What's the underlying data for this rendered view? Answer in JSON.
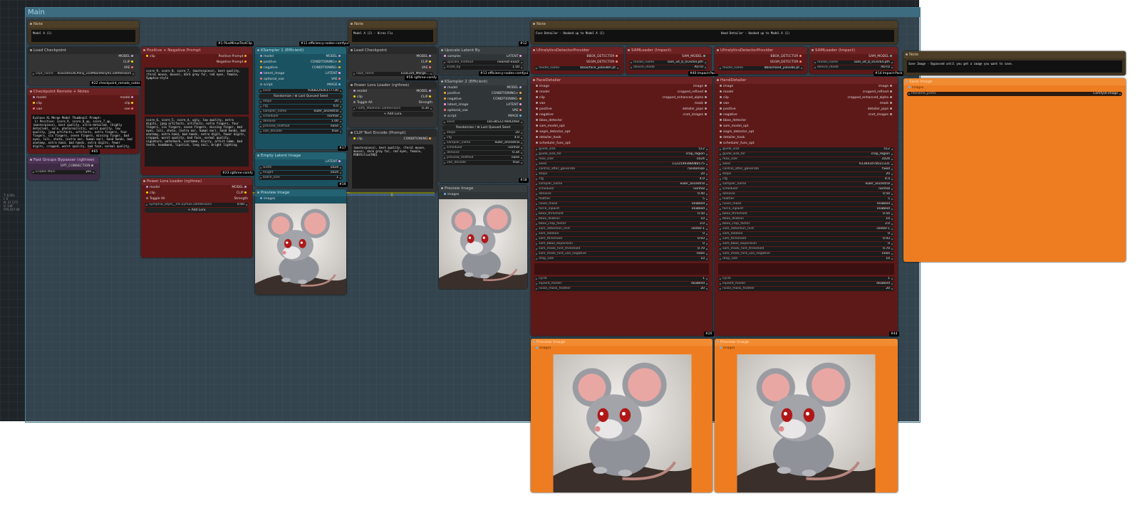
{
  "group": {
    "title": "Main"
  },
  "stats": [
    "T: 6.00s",
    "I: 0",
    "N: 27 [27]",
    "V: 138",
    "FPS:167.00"
  ],
  "notes": {
    "n1": {
      "title": "Note",
      "text": "Model A (1)"
    },
    "n2": {
      "title": "Note",
      "text": "Model A (2) - Hires Fix"
    },
    "n3": {
      "title": "Note",
      "text": "Face Detailer - Hooked up to Model A (1)"
    },
    "n4": {
      "title": "Note",
      "text": "Hand Detailer - Hooked up to Model A (1)"
    },
    "n5": {
      "title": "Note",
      "text": "Save Image - Bypassed until you get a image you want to save."
    }
  },
  "load_ckpt1": {
    "title": "Load Checkpoint",
    "outputs": [
      "MODEL",
      "CLIP",
      "VAE"
    ],
    "widget_label": "ckpt_name",
    "widget_value": "ecacomixXLPony_v10MainPony91.safetensors",
    "badge": "#22 checkpoint_remote_notes"
  },
  "ckpt_remote": {
    "title": "Checkpoint Remote + Notes",
    "inputs": [
      "model",
      "clip",
      "vae"
    ],
    "outputs": [
      "model",
      "clip",
      "vae"
    ],
    "text": "Evalove XL Merge Model Thumbnail Prompt:\n 1) Positive: score_9, score_8_up, score_7_up, (masterpiece), best quality, ultra-detailed, (highly detailed), solo, photorealistic, worst quality, low quality, jpeg artifacts, artifacts, extra fingers, four fingers, six fingers, seven fingers, missing finger, bad eyes, loli, shota, (extra ear, human ear), hand hands, bad anatomy, extra hand, bad hands, extra digits, fewer digits, cropped, worst quality, bad face, normal quality, signature, watermark, username, blurry, artist name, bad teeth, human ear, human ears, headband",
    "badge": "#65"
  },
  "bypasser": {
    "title": "Fast Groups Bypasser (rgthree)",
    "output": "OPT_CONNECTION",
    "label": "Enable Main",
    "value": "yes"
  },
  "prompt": {
    "title": "Positive + Negative Prompt",
    "inputs": [
      "clip"
    ],
    "outputs": [
      "Positive Prompt",
      "Negative Prompt"
    ],
    "badge_top": "#1 PlusMinusTextClip",
    "positive": "score_9, score_8, score_7, (masterpiece), best quality, (feral mouse, mouse), dark grey fur, red eyes, female, Symphia-style",
    "negative": "score_6, score_5, score_4, ugly, low quality, extra digits, jpeg artifacts, artifacts, extra fingers, four fingers, six fingers, seven fingers, missing finger, bad eyes, loli, shota, (extra ear, human ear), hand hands, bad anatomy, extra hand, bad hands, extra digit, fewer digits, cropped, worst quality, bad face, normal quality, signature, watermark, username, blurry, artist name, bad teeth, headband, lipstick, long nail, bright lighting",
    "badge_bottom": "#23 rgthree-comfy"
  },
  "lora1": {
    "title": "Power Lora Loader (rgthree)",
    "inputs": [
      "model",
      "clip"
    ],
    "outputs": [
      "MODEL",
      "CLIP"
    ],
    "toggle": "Toggle All",
    "strength_label": "Strength",
    "lora": "Symphia_Style__V4-Zymox.safetensors",
    "strength": "0.60",
    "add": "Add Lora"
  },
  "ks1": {
    "title": "KSampler 1 (Efficient)",
    "badge": "#11 efficiency-nodes-comfyui",
    "inputs": [
      "model",
      "positive",
      "negative",
      "latent_image",
      "optional_vae",
      "script"
    ],
    "outputs": [
      "MODEL",
      "CONDITIONING+",
      "CONDITIONING-",
      "LATENT",
      "VAE",
      "IMAGE"
    ],
    "seed_label": "seed",
    "seed": "936822926177730",
    "seed_btn": "Randomize / ♻ Last Queued Seed",
    "widgets": [
      [
        "steps",
        "20"
      ],
      [
        "cfg",
        "6.0"
      ],
      [
        "sampler_name",
        "euler_ancestral"
      ],
      [
        "scheduler",
        "normal"
      ],
      [
        "denoise",
        "1.00"
      ],
      [
        "preview_method",
        "none"
      ],
      [
        "vae_decode",
        "true"
      ]
    ],
    "badge2": "#17"
  },
  "latent": {
    "title": "Empty Latent Image",
    "output": "LATENT",
    "widgets": [
      [
        "width",
        "1024"
      ],
      [
        "height",
        "1024"
      ],
      [
        "batch_size",
        "1"
      ]
    ],
    "badge": "#19"
  },
  "preview1": {
    "title": "Preview Image",
    "input": "images"
  },
  "load_ckpt2": {
    "title": "Load Checkpoint",
    "outputs": [
      "MODEL",
      "CLIP",
      "VAE"
    ],
    "widget_label": "ckpt_name",
    "widget_value": "EvaCore_Merge...",
    "badge": "#56 rgthree-comfy"
  },
  "lora2": {
    "title": "Power Lora Loader (rgthree)",
    "inputs": [
      "model",
      "clip"
    ],
    "outputs": [
      "MODEL",
      "CLIP"
    ],
    "toggle": "Toggle All",
    "strength_label": "Strength",
    "lora": "Fluffy_Madness.safetensors",
    "strength": "0.30",
    "add": "Add Lora"
  },
  "clip_enc": {
    "title": "CLIP Text Encode (Prompt)",
    "input": "clip",
    "output": "CONDITIONING",
    "text": "(masterpiece), best quality, (feral mouse, mouse), dark grey fur, red eyes, female, PONYVillanTHS1"
  },
  "upscale": {
    "title": "Upscale Latent By",
    "badge": "#12",
    "input": "samples",
    "output": "LATENT",
    "widgets": [
      [
        "upscale_method",
        "nearest-exact"
      ],
      [
        "scale_by",
        "1.50"
      ]
    ],
    "badge2": "#13 efficiency-nodes-comfyui"
  },
  "ks2": {
    "title": "KSampler 2 (Efficient)",
    "inputs": [
      "model",
      "positive",
      "negative",
      "latent_image",
      "optional_vae",
      "script"
    ],
    "outputs": [
      "MODEL",
      "CONDITIONING+",
      "CONDITIONING-",
      "LATENT",
      "VAE",
      "IMAGE"
    ],
    "seed_label": "seed",
    "seed": "1813852278042064",
    "seed_btn": "Randomize / ♻ Last Queued Seed",
    "widgets": [
      [
        "steps",
        "20"
      ],
      [
        "cfg",
        "4.0"
      ],
      [
        "sampler_name",
        "euler_ancestral"
      ],
      [
        "scheduler",
        "normal"
      ],
      [
        "denoise",
        "0.34"
      ],
      [
        "preview_method",
        "none"
      ],
      [
        "vae_decode",
        "true"
      ]
    ],
    "badge": "#18"
  },
  "preview2": {
    "title": "Preview Image",
    "input": "images"
  },
  "ultra1": {
    "title": "UltralyticsDetectorProvider",
    "outputs": [
      "BBOX_DETECTOR",
      "SEGM_DETECTOR"
    ],
    "label": "model_name",
    "value": "bbox/face_yolov8m.pt"
  },
  "sam1": {
    "title": "SAMLoader (Impact)",
    "output": "SAM_MODEL",
    "widgets": [
      [
        "model_name",
        "sam_vit_b_01ec64.pth"
      ],
      [
        "device_mode",
        "AUTO"
      ]
    ],
    "badge": "#40 Impact-Pack"
  },
  "ultra2": {
    "title": "UltralyticsDetectorProvider",
    "outputs": [
      "BBOX_DETECTOR",
      "SEGM_DETECTOR"
    ],
    "label": "model_name",
    "value": "bbox/hand_yolov8s.pt"
  },
  "sam2": {
    "title": "SAMLoader (Impact)",
    "output": "SAM_MODEL",
    "widgets": [
      [
        "model_name",
        "sam_vit_b_01ec64.pth"
      ],
      [
        "device_mode",
        "AUTO"
      ]
    ],
    "badge": "#14 Impact-Pack"
  },
  "face": {
    "title": "FaceDetailer",
    "inputs": [
      "image",
      "model",
      "clip",
      "vae",
      "positive",
      "negative",
      "bbox_detector",
      "sam_model_opt",
      "segm_detector_opt",
      "detailer_hook",
      "scheduler_func_opt"
    ],
    "outputs": [
      "image",
      "cropped_refined",
      "cropped_enhanced_alpha",
      "mask",
      "detailer_pipe",
      "cnet_images"
    ],
    "widgets": [
      [
        "guide_size",
        "512"
      ],
      [
        "guide_size_for",
        "crop_region"
      ],
      [
        "max_size",
        "1024"
      ],
      [
        "seed",
        "1122549388086575"
      ],
      [
        "control_after_generate",
        "randomize"
      ],
      [
        "steps",
        "20"
      ],
      [
        "cfg",
        "4.0"
      ],
      [
        "sampler_name",
        "euler_ancestral"
      ],
      [
        "scheduler",
        "normal"
      ],
      [
        "denoise",
        "0.40"
      ],
      [
        "feather",
        "5"
      ],
      [
        "noise_mask",
        "enabled"
      ],
      [
        "force_inpaint",
        "enabled"
      ],
      [
        "bbox_threshold",
        "0.50"
      ],
      [
        "bbox_dilation",
        "10"
      ],
      [
        "bbox_crop_factor",
        "3.0"
      ],
      [
        "sam_detection_hint",
        "center-1"
      ],
      [
        "sam_dilation",
        "0"
      ],
      [
        "sam_threshold",
        "0.93"
      ],
      [
        "sam_bbox_expansion",
        "0"
      ],
      [
        "sam_mask_hint_threshold",
        "0.70"
      ],
      [
        "sam_mask_hint_use_negative",
        "False"
      ],
      [
        "drop_size",
        "10"
      ]
    ],
    "widgets2": [
      [
        "cycle",
        "1"
      ],
      [
        "inpaint_model",
        "disabled"
      ],
      [
        "noise_mask_feather",
        "20"
      ]
    ],
    "badge": "#20"
  },
  "hand": {
    "title": "HandDetailer",
    "inputs": [
      "image",
      "model",
      "clip",
      "vae",
      "positive",
      "negative",
      "bbox_detector",
      "sam_model_opt",
      "segm_detector_opt",
      "detailer_hook",
      "scheduler_func_opt"
    ],
    "outputs": [
      "image",
      "cropped_refined",
      "cropped_enhanced_alpha",
      "mask",
      "detailer_pipe",
      "cnet_images"
    ],
    "widgets": [
      [
        "guide_size",
        "512"
      ],
      [
        "guide_size_for",
        "crop_region"
      ],
      [
        "max_size",
        "1024"
      ],
      [
        "seed",
        "613643478521331"
      ],
      [
        "control_after_generate",
        "fixed"
      ],
      [
        "steps",
        "20"
      ],
      [
        "cfg",
        "4.0"
      ],
      [
        "sampler_name",
        "euler_ancestral"
      ],
      [
        "scheduler",
        "normal"
      ],
      [
        "denoise",
        "0.50"
      ],
      [
        "feather",
        "5"
      ],
      [
        "noise_mask",
        "enabled"
      ],
      [
        "force_inpaint",
        "enabled"
      ],
      [
        "bbox_threshold",
        "0.50"
      ],
      [
        "bbox_dilation",
        "10"
      ],
      [
        "bbox_crop_factor",
        "3.0"
      ],
      [
        "sam_detection_hint",
        "center-1"
      ],
      [
        "sam_dilation",
        "0"
      ],
      [
        "sam_threshold",
        "0.93"
      ],
      [
        "sam_bbox_expansion",
        "0"
      ],
      [
        "sam_mask_hint_threshold",
        "0.70"
      ],
      [
        "sam_mask_hint_use_negative",
        "False"
      ],
      [
        "drop_size",
        "10"
      ]
    ],
    "widgets2": [
      [
        "cycle",
        "1"
      ],
      [
        "inpaint_model",
        "disabled"
      ],
      [
        "noise_mask_feather",
        "20"
      ]
    ],
    "badge": "#44"
  },
  "preview3": {
    "title": "Preview Image",
    "input": "images"
  },
  "preview4": {
    "title": "Preview Image",
    "input": "images"
  },
  "save": {
    "title": "Save Image",
    "input": "images",
    "label": "filename_prefix",
    "value": "ComfyUI-image"
  }
}
